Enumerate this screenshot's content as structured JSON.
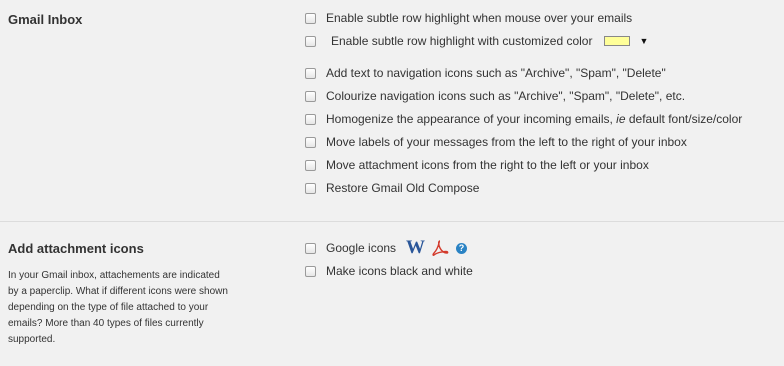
{
  "gmail_inbox": {
    "title": "Gmail Inbox",
    "options": [
      "Enable subtle row highlight when mouse over your emails",
      "Enable subtle row highlight with customized color",
      "Add text to navigation icons such as \"Archive\", \"Spam\", \"Delete\"",
      "Colourize navigation icons such as \"Archive\", \"Spam\", \"Delete\", etc.",
      "Homogenize the appearance of your incoming emails,",
      "Move labels of your messages from the left to the right of your inbox",
      "Move attachment icons from the right to the left or your inbox",
      "Restore Gmail Old Compose"
    ],
    "homogenize_italic": "ie",
    "homogenize_rest": "default font/size/color",
    "highlight_color": "#ffff99",
    "dropdown_arrow": "▼"
  },
  "attachment_icons": {
    "title": "Add attachment icons",
    "description": "In your Gmail inbox, attachements are indicated by a paperclip. What if different icons were shown depending on the type of file attached to your emails? More than 40 types of files currently supported.",
    "options": [
      "Google icons",
      "Make icons black and white"
    ],
    "word_icon_letter": "W",
    "help_icon_glyph": "?",
    "icons": [
      "word-icon",
      "pdf-icon",
      "help-icon"
    ]
  }
}
